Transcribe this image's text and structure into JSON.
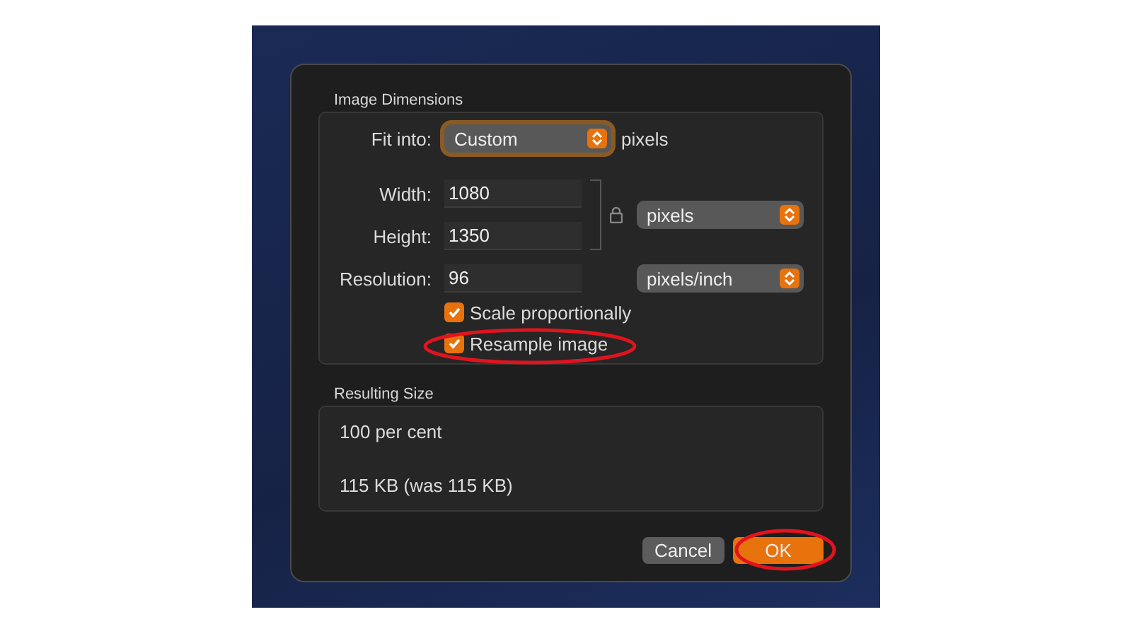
{
  "dimensions": {
    "title": "Image Dimensions",
    "fit_into": {
      "label": "Fit into:",
      "value": "Custom",
      "unit": "pixels",
      "focused": true
    },
    "width": {
      "label": "Width:",
      "value": "1080"
    },
    "height": {
      "label": "Height:",
      "value": "1350"
    },
    "size_unit": "pixels",
    "resolution": {
      "label": "Resolution:",
      "value": "96",
      "unit": "pixels/inch"
    },
    "checkboxes": [
      {
        "label": "Scale proportionally",
        "checked": true,
        "circled": false
      },
      {
        "label": "Resample image",
        "checked": true,
        "circled": true
      }
    ]
  },
  "result": {
    "title": "Resulting Size",
    "percent": "100 per cent",
    "file_size": "115 KB (was 115 KB)"
  },
  "buttons": [
    {
      "label": "Cancel",
      "default": false,
      "circled": false
    },
    {
      "label": "OK",
      "default": true,
      "circled": true
    }
  ]
}
